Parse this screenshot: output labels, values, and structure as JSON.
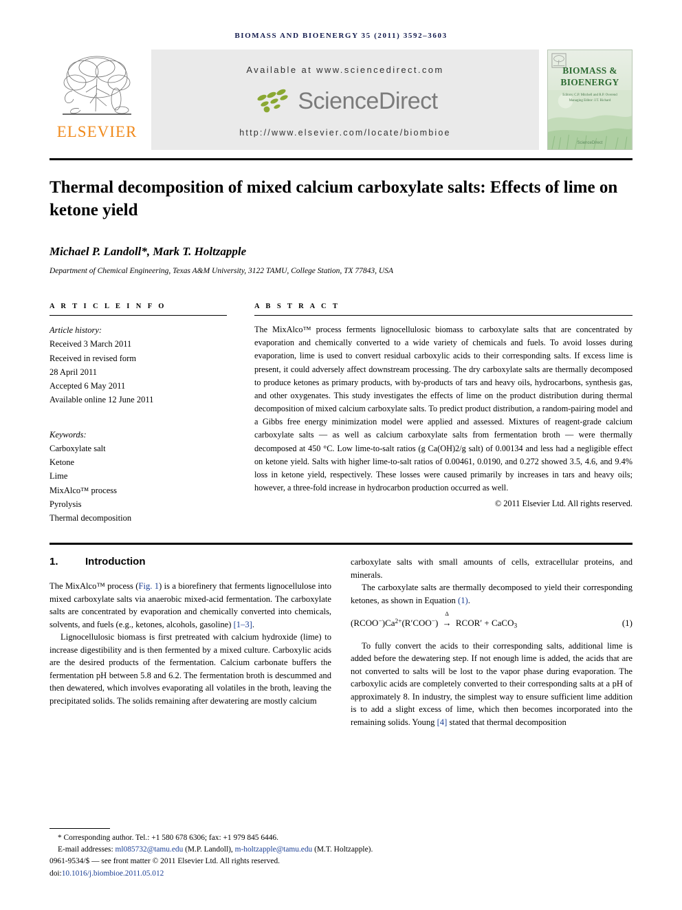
{
  "running_head": "BIOMASS AND BIOENERGY 35 (2011) 3592–3603",
  "masthead": {
    "publisher_name": "ELSEVIER",
    "available_at": "Available at www.sciencedirect.com",
    "sciencedirect_wordmark": "ScienceDirect",
    "journal_url": "http://www.elsevier.com/locate/biombioe",
    "cover": {
      "title_line1": "BIOMASS &",
      "title_line2": "BIOENERGY",
      "editors_line1": "Editors: C.P. Mitchell and R.P. Overend",
      "editors_line2": "Managing Editor: J.T. Richard",
      "sciencedirect_mark": "ScienceDirect"
    }
  },
  "article": {
    "title": "Thermal decomposition of mixed calcium carboxylate salts: Effects of lime on ketone yield",
    "authors": "Michael P. Landoll*, Mark T. Holtzapple",
    "affiliation": "Department of Chemical Engineering, Texas A&M University, 3122 TAMU, College Station, TX 77843, USA"
  },
  "article_info": {
    "heading": "A R T I C L E   I N F O",
    "history_label": "Article history:",
    "history": [
      "Received 3 March 2011",
      "Received in revised form",
      "28 April 2011",
      "Accepted 6 May 2011",
      "Available online 12 June 2011"
    ],
    "keywords_label": "Keywords:",
    "keywords": [
      "Carboxylate salt",
      "Ketone",
      "Lime",
      "MixAlco™ process",
      "Pyrolysis",
      "Thermal decomposition"
    ]
  },
  "abstract": {
    "heading": "A B S T R A C T",
    "text": "The MixAlco™ process ferments lignocellulosic biomass to carboxylate salts that are concentrated by evaporation and chemically converted to a wide variety of chemicals and fuels. To avoid losses during evaporation, lime is used to convert residual carboxylic acids to their corresponding salts. If excess lime is present, it could adversely affect downstream processing. The dry carboxylate salts are thermally decomposed to produce ketones as primary products, with by-products of tars and heavy oils, hydrocarbons, synthesis gas, and other oxygenates. This study investigates the effects of lime on the product distribution during thermal decomposition of mixed calcium carboxylate salts. To predict product distribution, a random-pairing model and a Gibbs free energy minimization model were applied and assessed. Mixtures of reagent-grade calcium carboxylate salts — as well as calcium carboxylate salts from fermentation broth — were thermally decomposed at 450 °C. Low lime-to-salt ratios (g Ca(OH)2/g salt) of 0.00134 and less had a negligible effect on ketone yield. Salts with higher lime-to-salt ratios of 0.00461, 0.0190, and 0.272 showed 3.5, 4.6, and 9.4% loss in ketone yield, respectively. These losses were caused primarily by increases in tars and heavy oils; however, a three-fold increase in hydrocarbon production occurred as well.",
    "copyright": "© 2011 Elsevier Ltd. All rights reserved."
  },
  "introduction": {
    "number": "1.",
    "heading": "Introduction",
    "left_p1_a": "The MixAlco™ process (",
    "left_p1_fig_link": "Fig. 1",
    "left_p1_b": ") is a biorefinery that ferments lignocellulose into mixed carboxylate salts via anaerobic mixed-acid fermentation. The carboxylate salts are concentrated by evaporation and chemically converted into chemicals, solvents, and fuels (e.g., ketones, alcohols, gasoline) ",
    "left_p1_ref_link": "[1–3]",
    "left_p1_c": ".",
    "left_p2": "Lignocellulosic biomass is first pretreated with calcium hydroxide (lime) to increase digestibility and is then fermented by a mixed culture. Carboxylic acids are the desired products of the fermentation. Calcium carbonate buffers the fermentation pH between 5.8 and 6.2. The fermentation broth is descummed and then dewatered, which involves evaporating all volatiles in the broth, leaving the precipitated solids. The solids remaining after dewatering are mostly calcium",
    "right_p1": "carboxylate salts with small amounts of cells, extracellular proteins, and minerals.",
    "right_p2_a": "The carboxylate salts are thermally decomposed to yield their corresponding ketones, as shown in Equation ",
    "right_p2_link": "(1)",
    "right_p2_b": ".",
    "equation_number": "(1)",
    "right_p3_a": "To fully convert the acids to their corresponding salts, additional lime is added before the dewatering step. If not enough lime is added, the acids that are not converted to salts will be lost to the vapor phase during evaporation. The carboxylic acids are completely converted to their corresponding salts at a pH of approximately 8. In industry, the simplest way to ensure sufficient lime addition is to add a slight excess of lime, which then becomes incorporated into the remaining solids. Young ",
    "right_p3_link": "[4]",
    "right_p3_b": " stated that thermal decomposition"
  },
  "footnotes": {
    "corresponding": "* Corresponding author. Tel.: +1 580 678 6306; fax: +1 979 845 6446.",
    "email_label": "E-mail addresses: ",
    "email1": "ml085732@tamu.edu",
    "email1_who": " (M.P. Landoll), ",
    "email2": "m-holtzapple@tamu.edu",
    "email2_who": " (M.T. Holtzapple).",
    "issn_line": "0961-9534/$ — see front matter © 2011 Elsevier Ltd. All rights reserved.",
    "doi_label": "doi:",
    "doi_value": "10.1016/j.biombioe.2011.05.012"
  },
  "colors": {
    "running_head": "#131b4d",
    "link": "#1c3f94",
    "elsevier_orange": "#f08a1c",
    "sciencedirect_gray": "#7b7b7b",
    "sciencedirect_green": "#8aa832",
    "cover_green": "#2d6b33"
  }
}
